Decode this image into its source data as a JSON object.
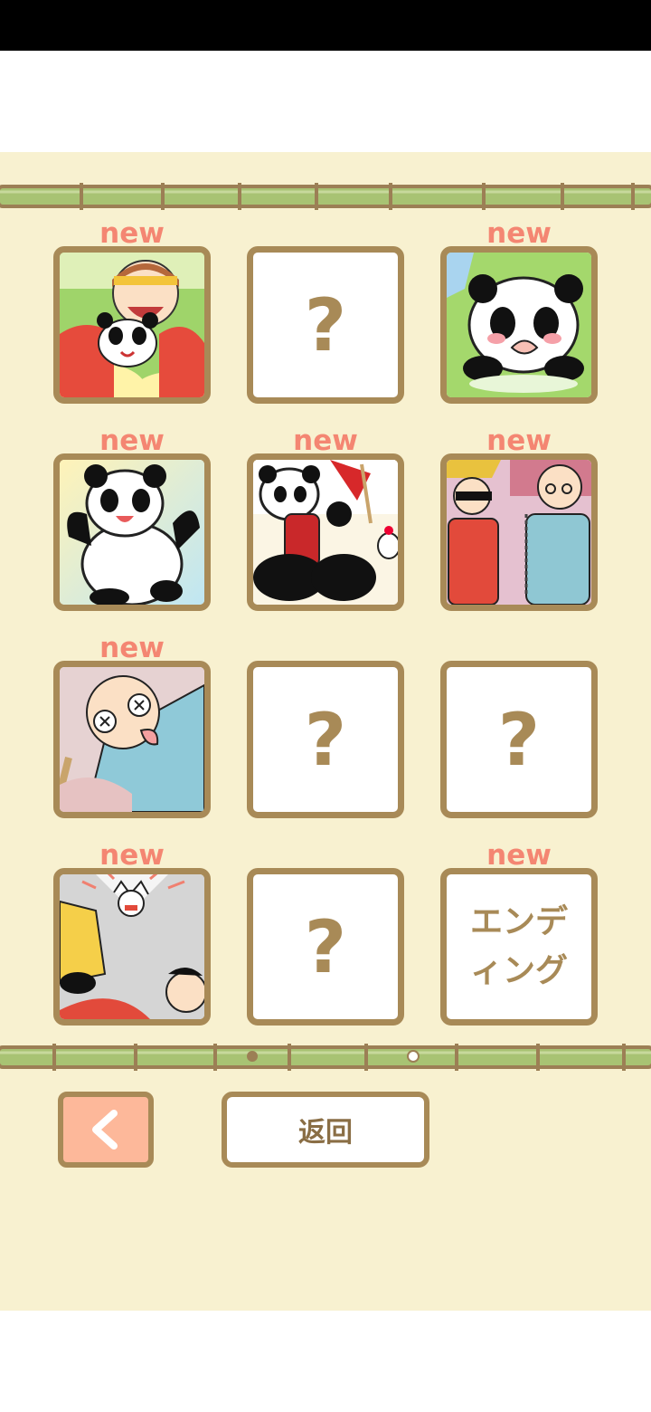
{
  "colors": {
    "background": "#f8f1d0",
    "border": "#a88a57",
    "new_badge": "#f48672",
    "back_button": "#fdb89a",
    "bamboo": "#a8c373"
  },
  "gallery": {
    "new_label": "new",
    "locked_label": "?",
    "ending_label_line1": "エンデ",
    "ending_label_line2": "ィング",
    "cells": [
      {
        "state": "unlocked",
        "new": true,
        "image": "monkey-king-holding-panda"
      },
      {
        "state": "locked",
        "new": false
      },
      {
        "state": "unlocked",
        "new": true,
        "image": "crying-panda-on-grass"
      },
      {
        "state": "unlocked",
        "new": true,
        "image": "happy-panda-arms-up"
      },
      {
        "state": "unlocked",
        "new": true,
        "image": "panda-with-red-barrel"
      },
      {
        "state": "unlocked",
        "new": true,
        "image": "workers-in-red-and-blue"
      },
      {
        "state": "unlocked",
        "new": true,
        "image": "dizzy-old-man"
      },
      {
        "state": "locked",
        "new": false
      },
      {
        "state": "locked",
        "new": false
      },
      {
        "state": "unlocked",
        "new": true,
        "image": "angry-cat-scene"
      },
      {
        "state": "locked",
        "new": false
      },
      {
        "state": "ending",
        "new": true
      }
    ]
  },
  "pagination": {
    "page_count": 2,
    "current_page": 2
  },
  "nav": {
    "back_icon": "chevron-left-icon",
    "return_label": "返回"
  }
}
